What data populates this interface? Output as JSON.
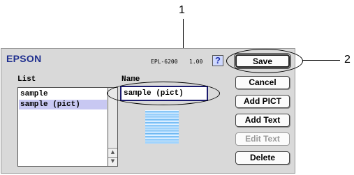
{
  "callouts": [
    "1",
    "2"
  ],
  "header": {
    "brand": "EPSON",
    "model": "EPL-6200",
    "version": "1.00",
    "help_label": "?"
  },
  "list": {
    "label": "List",
    "items": [
      {
        "label": "sample",
        "selected": false
      },
      {
        "label": "sample (pict)",
        "selected": true
      }
    ]
  },
  "name": {
    "label": "Name",
    "value": "sample (pict)"
  },
  "buttons": {
    "save": "Save",
    "cancel": "Cancel",
    "add_pict": "Add PICT",
    "add_text": "Add Text",
    "edit_text": "Edit Text",
    "delete": "Delete"
  },
  "icons": {
    "thumbnail": "pict-thumbnail-icon",
    "help": "help-icon"
  },
  "colors": {
    "brand": "#1f2f8f",
    "selection": "#c8c8f2",
    "name_field_border": "#1a1a6e"
  }
}
